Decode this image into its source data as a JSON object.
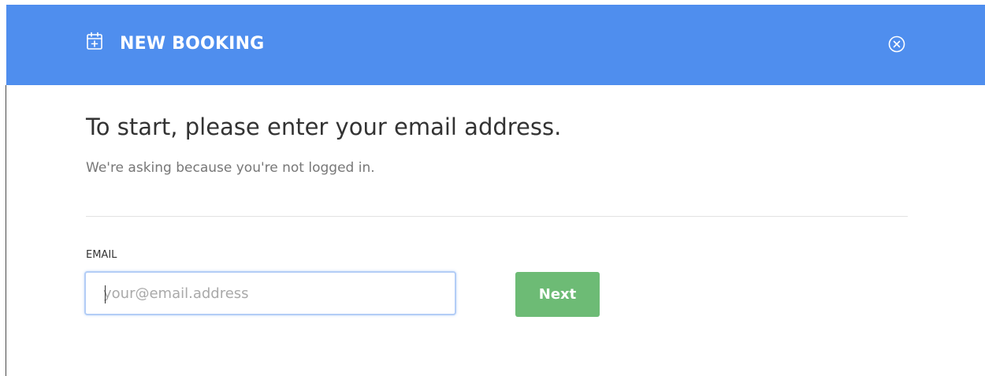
{
  "modal": {
    "title": "NEW BOOKING",
    "header_color": "#4f8eee",
    "title_icon": "calendar-plus-icon",
    "close_icon": "close-circle-icon"
  },
  "form": {
    "heading": "To start, please enter your email address.",
    "subheading": "We're asking because you're not logged in.",
    "email_label": "EMAIL",
    "email_value": "",
    "email_placeholder": "your@email.address",
    "next_label": "Next",
    "next_color": "#6dbb75"
  }
}
